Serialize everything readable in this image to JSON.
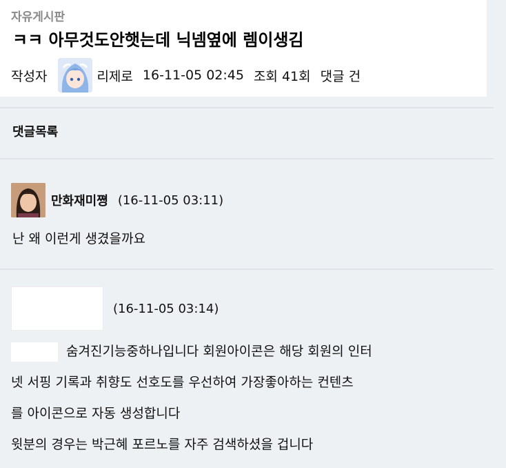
{
  "post": {
    "board_name": "자유게시판",
    "title": "ㅋㅋ 아무것도안햇는데 닉넴옆에 렘이생김",
    "author_label": "작성자",
    "author": "리제로",
    "date": "16-11-05 02:45",
    "views": "조회 41회",
    "comments_count": "댓글  건"
  },
  "comments_section": {
    "title": "댓글목록"
  },
  "comments": [
    {
      "author": "만화재미쪙",
      "date": "(16-11-05 03:11)",
      "body": "난 왜 이런게 생겼을까요"
    },
    {
      "author": "",
      "date": "(16-11-05 03:14)",
      "lines": [
        "숨겨진기능중하나입니다 회원아이콘은 해당 회원의 인터",
        "넷 서핑 기록과 취향도 선호도를 우선하여 가장좋아하는 컨텐츠",
        "를 아이콘으로 자동 생성합니다",
        "윗분의 경우는 박근혜 포르노를 자주 검색하셨을 겁니다"
      ]
    }
  ]
}
